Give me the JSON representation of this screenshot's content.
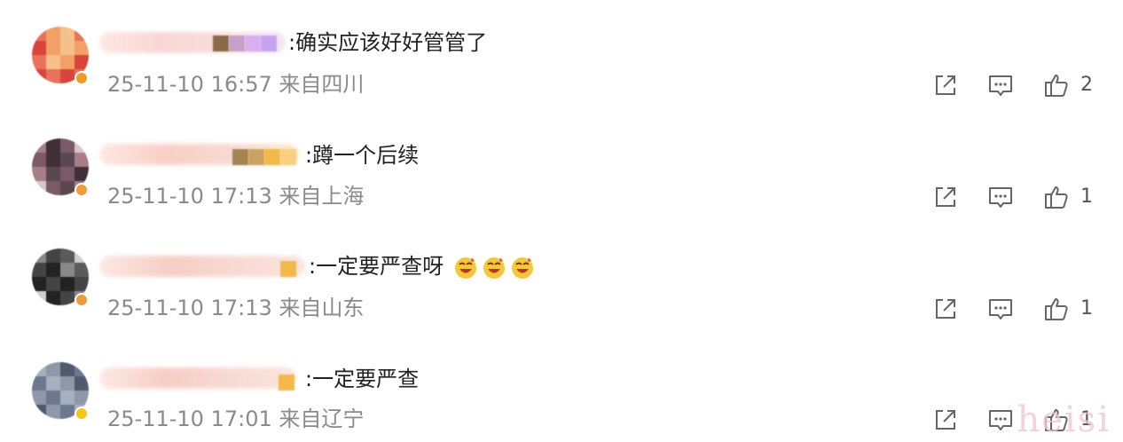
{
  "comments": [
    {
      "text": ":确实应该好好管管了",
      "time": "25-11-10 16:57",
      "location": "来自四川",
      "likes": "2",
      "avatar_colors": [
        "#e8735a",
        "#f3a067",
        "#d9453b",
        "#f5c08a"
      ],
      "badge_color": "#f09a2c"
    },
    {
      "text": ":蹲一个后续",
      "time": "25-11-10 17:13",
      "location": "来自上海",
      "likes": "1",
      "avatar_colors": [
        "#7b5a66",
        "#3f2f36",
        "#a77d86",
        "#5b4750"
      ],
      "badge_color": "#f29a3a"
    },
    {
      "text": ":一定要严查呀",
      "time": "25-11-10 17:13",
      "location": "来自山东",
      "likes": "1",
      "avatar_colors": [
        "#444444",
        "#222222",
        "#888888",
        "#5a5a5a"
      ],
      "badge_color": "#f29a3a"
    },
    {
      "text": ":一定要严查",
      "time": "25-11-10 17:01",
      "location": "来自辽宁",
      "likes": "1",
      "avatar_colors": [
        "#6b7890",
        "#8f98a8",
        "#4e5a70",
        "#a7b0bd"
      ],
      "badge_color": "#f5c518"
    }
  ],
  "icons": {
    "share": "share-icon",
    "comment": "comment-icon",
    "like": "thumbs-up-icon"
  },
  "watermark": "heisi"
}
